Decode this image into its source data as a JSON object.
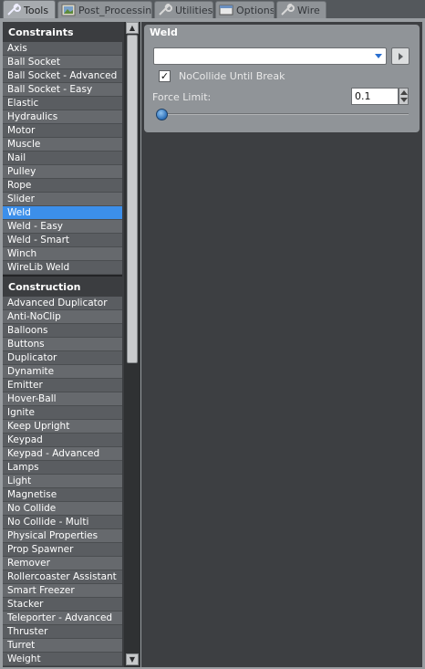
{
  "tabs": [
    {
      "label": "Tools",
      "icon": "wrench-icon",
      "active": true
    },
    {
      "label": "Post_Processing",
      "icon": "image-icon",
      "active": false
    },
    {
      "label": "Utilities",
      "icon": "wrench-icon",
      "active": false
    },
    {
      "label": "Options",
      "icon": "window-icon",
      "active": false
    },
    {
      "label": "Wire",
      "icon": "wire-icon",
      "active": false
    }
  ],
  "categories": [
    {
      "name": "Constraints",
      "items": [
        "Axis",
        "Ball Socket",
        "Ball Socket - Advanced",
        "Ball Socket - Easy",
        "Elastic",
        "Hydraulics",
        "Motor",
        "Muscle",
        "Nail",
        "Pulley",
        "Rope",
        "Slider",
        "Weld",
        "Weld - Easy",
        "Weld - Smart",
        "Winch",
        "WireLib Weld"
      ]
    },
    {
      "name": "Construction",
      "items": [
        "Advanced Duplicator",
        "Anti-NoClip",
        "Balloons",
        "Buttons",
        "Duplicator",
        "Dynamite",
        "Emitter",
        "Hover-Ball",
        "Ignite",
        "Keep Upright",
        "Keypad",
        "Keypad - Advanced",
        "Lamps",
        "Light",
        "Magnetise",
        "No Collide",
        "No Collide - Multi",
        "Physical Properties",
        "Prop Spawner",
        "Remover",
        "Rollercoaster Assistant",
        "Smart Freezer",
        "Stacker",
        "Teleporter - Advanced",
        "Thruster",
        "Turret",
        "Weight"
      ]
    }
  ],
  "selected_tool": "Weld",
  "weld_panel": {
    "title": "Weld",
    "preset_value": "",
    "nocollide_label": "NoCollide Until Break",
    "nocollide_checked": true,
    "force_limit_label": "Force Limit:",
    "force_limit_value": "0.1",
    "force_limit_slider_fraction": 0.0
  },
  "colors": {
    "selection": "#3c8fea",
    "list_row_odd": "#5a5d61",
    "list_row_even": "#66696d",
    "panel": "#909498"
  }
}
